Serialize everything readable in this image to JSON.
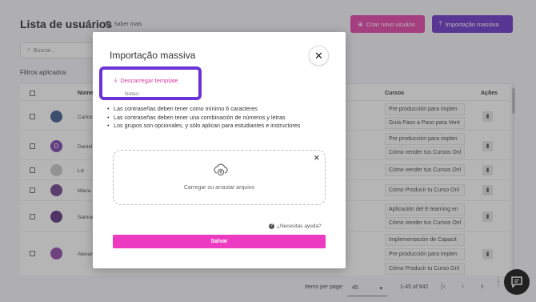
{
  "page": {
    "title": "Lista de usuários",
    "help_link": "Saber mais",
    "create_button": "Criar novo usuário",
    "import_button": "Importação massiva",
    "search_placeholder": "Buscar...",
    "filters_label": "Filtros aplicados",
    "columns": {
      "name": "Nome",
      "courses": "Cursos",
      "actions": "Ações"
    },
    "rows": [
      {
        "name": "Carlos",
        "courses": [
          "Pre producción para implen",
          "Guía Paso a Paso para Vent"
        ]
      },
      {
        "name": "Daniel",
        "courses": [
          "Pre producción para implen",
          "Cómo vender tus Cursos Onl"
        ]
      },
      {
        "name": "Liz",
        "courses": [
          "Cómo vender tus Cursos Onl"
        ]
      },
      {
        "name": "Maria",
        "courses": [
          "Cómo Producir tu Curso Onl"
        ]
      },
      {
        "name": "Samuel",
        "courses": [
          "Aplicación del E-learning en",
          "Cómo vender tus Cursos Onl"
        ]
      },
      {
        "name": "Alexandra",
        "courses": [
          "Implementación de Capacit",
          "Pre producción para implen",
          "Cómo Producir tu Curso Onl"
        ]
      }
    ],
    "avatar_letter": "D",
    "pagination": {
      "items_per_page_label": "Items per page:",
      "items_per_page": "45",
      "range": "1-45 of 842"
    }
  },
  "modal": {
    "title": "Importação massiva",
    "download_link": "Descarregar template",
    "notes_label": "Notas:",
    "notes": [
      "Las contraseñas deben tener como mínimo 6 caracteres",
      "Las contraseñas deben tener una combinación de números y letras",
      "Los grupos son opcionales, y sólo aplican para estudiantes e instructores"
    ],
    "dropzone_text": "Carregar ou arrastar arquivo",
    "help_text": "¿Necesitas ayuda?",
    "save_button": "Salvar"
  },
  "colors": {
    "accent_pink": "#ec3bc0",
    "accent_purple": "#6a33c9",
    "highlight": "#6a33d6"
  }
}
